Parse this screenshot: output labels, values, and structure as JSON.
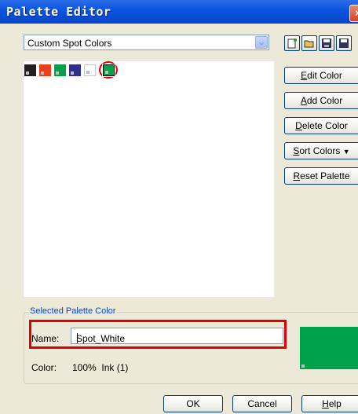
{
  "window": {
    "title": "Palette Editor",
    "close_glyph": "×"
  },
  "palette_select": {
    "value": "Custom Spot Colors",
    "arrow_glyph": "⌵"
  },
  "toolbar": {
    "icons": [
      "new-palette-icon",
      "open-palette-icon",
      "save-palette-icon",
      "save-as-palette-icon"
    ]
  },
  "swatches": [
    {
      "color": "#231f20"
    },
    {
      "color": "#e8401c"
    },
    {
      "color": "#00a14b"
    },
    {
      "color": "#2e2e8c"
    },
    {
      "color": "#ffffff"
    },
    {
      "color": "#00a14b",
      "selected": true
    }
  ],
  "side_buttons": {
    "edit": {
      "u": "E",
      "rest": "dit Color"
    },
    "add": {
      "u": "A",
      "rest": "dd Color"
    },
    "delete": {
      "u": "D",
      "rest": "elete Color"
    },
    "sort": {
      "u": "S",
      "rest": "ort Colors",
      "arrow": "▼"
    },
    "reset": {
      "u": "R",
      "rest": "eset Palette"
    }
  },
  "selected": {
    "group_title": "Selected Palette Color",
    "name_label": "Name:",
    "name_value": "Spot_White",
    "color_label": "Color:",
    "color_value": "100%  Ink (1)",
    "preview_color": "#00a14b"
  },
  "dialog_buttons": {
    "ok": "OK",
    "cancel": "Cancel",
    "help": {
      "u": "H",
      "rest": "elp"
    }
  },
  "annotation_color": "#e00000"
}
